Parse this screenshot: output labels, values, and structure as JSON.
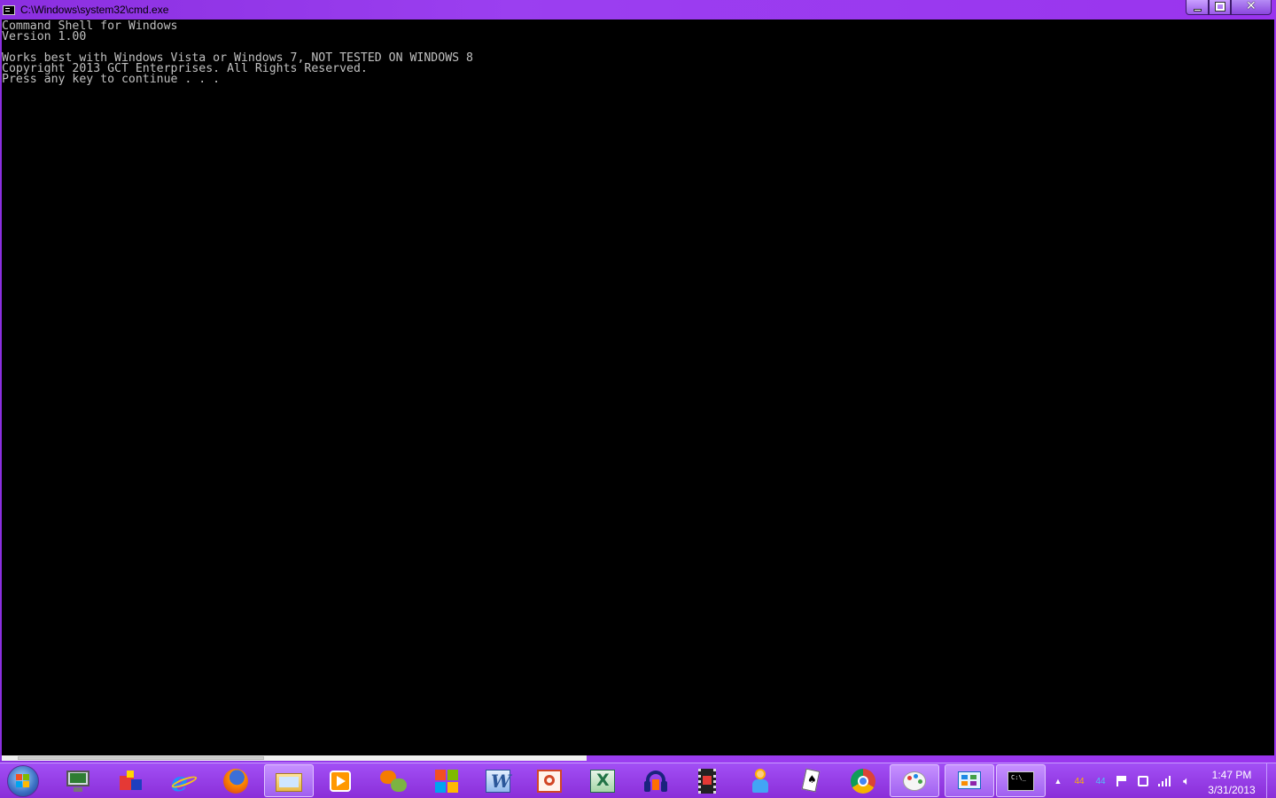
{
  "window": {
    "title": "C:\\Windows\\system32\\cmd.exe",
    "close_glyph": "✕"
  },
  "console": {
    "lines": [
      "Command Shell for Windows",
      "Version 1.00",
      "",
      "Works best with Windows Vista or Windows 7, NOT TESTED ON WINDOWS 8",
      "Copyright 2013 GCT Enterprises. All Rights Reserved.",
      "Press any key to continue . . ."
    ],
    "colors": {
      "background": "#000000",
      "text": "#c0c0c0"
    }
  },
  "taskbar": {
    "items": [
      {
        "icon": "remote-desktop-icon"
      },
      {
        "icon": "app-blocks-icon"
      },
      {
        "icon": "internet-explorer-icon"
      },
      {
        "icon": "firefox-icon"
      },
      {
        "icon": "windows-explorer-icon"
      },
      {
        "icon": "media-player-icon"
      },
      {
        "icon": "join-me-icon"
      },
      {
        "icon": "windows-logo-app-icon"
      },
      {
        "icon": "word-icon"
      },
      {
        "icon": "powerpoint-icon"
      },
      {
        "icon": "excel-icon"
      },
      {
        "icon": "audacity-icon"
      },
      {
        "icon": "movie-maker-icon"
      },
      {
        "icon": "user-figure-icon"
      },
      {
        "icon": "solitaire-icon"
      },
      {
        "icon": "chrome-icon"
      },
      {
        "icon": "paint-icon"
      },
      {
        "icon": "control-panel-icon"
      },
      {
        "icon": "cmd-icon"
      }
    ],
    "tray": {
      "badge_1": "44",
      "badge_2": "44",
      "time": "1:47 PM",
      "date": "3/31/2013"
    }
  }
}
